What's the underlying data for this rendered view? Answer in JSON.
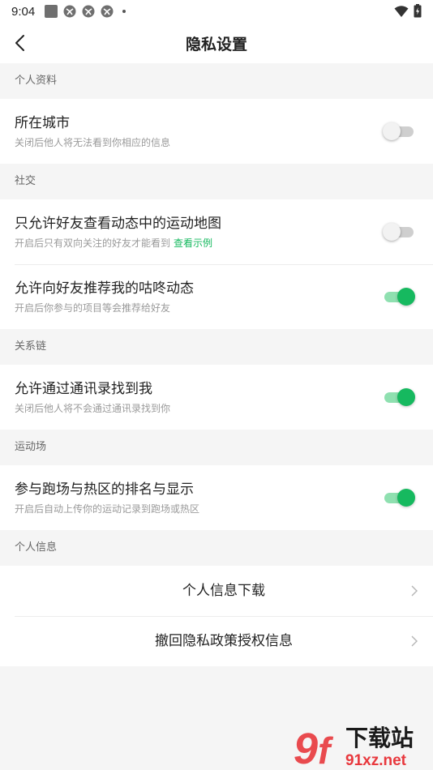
{
  "status": {
    "time": "9:04"
  },
  "nav": {
    "title": "隐私设置"
  },
  "sections": [
    {
      "header": "个人资料",
      "rows": [
        {
          "title": "所在城市",
          "subtitle": "关闭后他人将无法看到你相应的信息",
          "toggle": "off"
        }
      ]
    },
    {
      "header": "社交",
      "rows": [
        {
          "title": "只允许好友查看动态中的运动地图",
          "subtitle": "开启后只有双向关注的好友才能看到",
          "link": "查看示例",
          "toggle": "off"
        },
        {
          "title": "允许向好友推荐我的咕咚动态",
          "subtitle": "开启后你参与的项目等会推荐给好友",
          "toggle": "on"
        }
      ]
    },
    {
      "header": "关系链",
      "rows": [
        {
          "title": "允许通过通讯录找到我",
          "subtitle": "关闭后他人将不会通过通讯录找到你",
          "toggle": "on"
        }
      ]
    },
    {
      "header": "运动场",
      "rows": [
        {
          "title": "参与跑场与热区的排名与显示",
          "subtitle": "开启后自动上传你的运动记录到跑场或热区",
          "toggle": "on"
        }
      ]
    },
    {
      "header": "个人信息",
      "rows": [
        {
          "title": "个人信息下载"
        },
        {
          "title": "撤回隐私政策授权信息"
        }
      ]
    }
  ],
  "colors": {
    "accent": "#16b95f",
    "toggle_on_track": "#8fe0b0",
    "toggle_off_track": "#cfcfcf"
  },
  "watermark": {
    "brand": "下载站",
    "domain": "91xz.net"
  }
}
